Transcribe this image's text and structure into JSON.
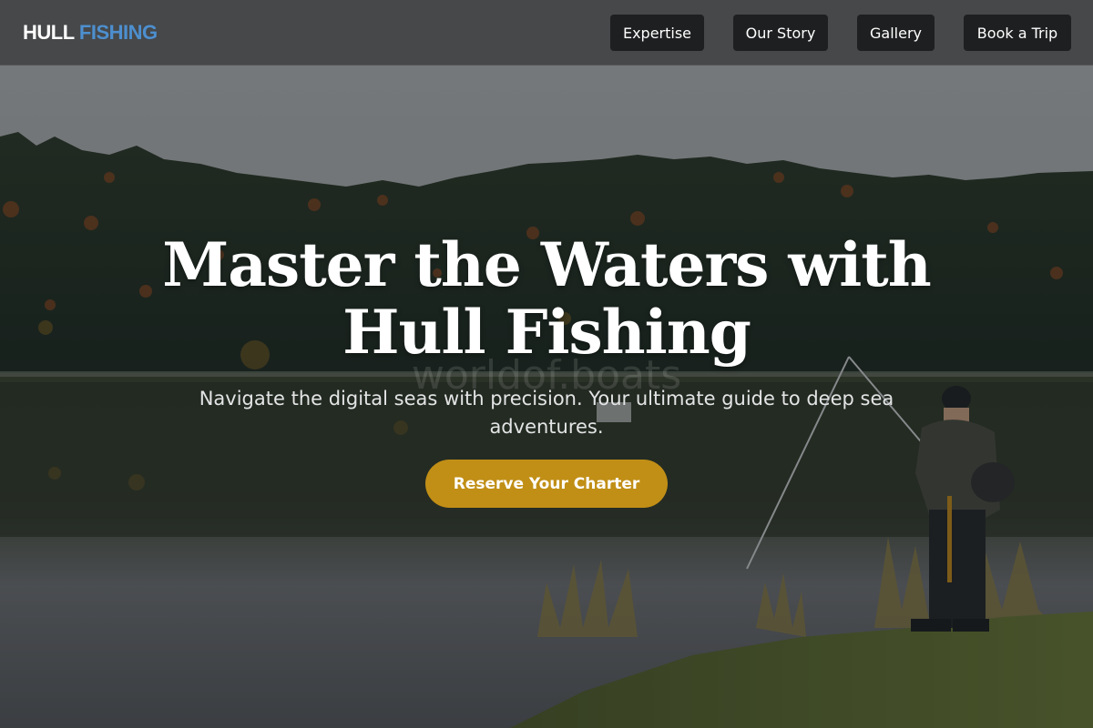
{
  "header": {
    "logo_primary": "HULL",
    "logo_accent": "FISHING",
    "nav": [
      {
        "label": "Expertise"
      },
      {
        "label": "Our Story"
      },
      {
        "label": "Gallery"
      },
      {
        "label": "Book a Trip"
      }
    ]
  },
  "hero": {
    "title_line1": "Master the Waters with",
    "title_line2": "Hull Fishing",
    "subtitle_line1": "Navigate the digital seas with precision. Your ultimate guide to deep sea",
    "subtitle_line2": "adventures.",
    "cta_label": "Reserve Your Charter",
    "watermark": "worldof.boats",
    "background_image": "lake-fisherman-photo"
  },
  "colors": {
    "logo_accent": "#4d8fcf",
    "header_bg": "#444648",
    "nav_button_bg": "#1e1f20",
    "cta_bg": "#c18f16"
  }
}
